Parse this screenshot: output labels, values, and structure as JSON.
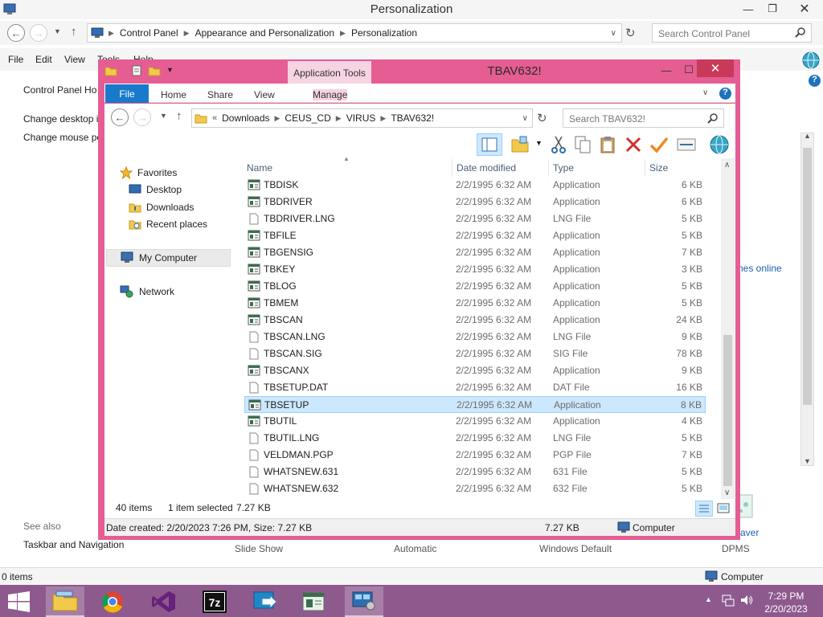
{
  "control_panel": {
    "title": "Personalization",
    "breadcrumbs": [
      "Control Panel",
      "Appearance and Personalization",
      "Personalization"
    ],
    "search_placeholder": "Search Control Panel",
    "menu": [
      "File",
      "Edit",
      "View",
      "Tools",
      "Help"
    ],
    "sidebar": {
      "home": "Control Panel Ho",
      "links": [
        "Change desktop i",
        "Change mouse po"
      ],
      "see_also_label": "See also",
      "see_also_links": [
        "Taskbar and Navigation"
      ]
    },
    "right_link_fragment": "nes online",
    "bottom_items": [
      "Slide Show",
      "Automatic",
      "Windows Default",
      "DPMS"
    ],
    "screen_saver_fragment": "aver",
    "status_left": "0 items",
    "status_right": "Computer"
  },
  "explorer": {
    "title": "TBAV632!",
    "contextual_tab": "Application Tools",
    "tabs": [
      "File",
      "Home",
      "Share",
      "View",
      "Manage"
    ],
    "breadcrumbs": [
      "Downloads",
      "CEUS_CD",
      "VIRUS",
      "TBAV632!"
    ],
    "search_placeholder": "Search TBAV632!",
    "nav_pane": {
      "favorites_label": "Favorites",
      "favorites": [
        "Desktop",
        "Downloads",
        "Recent places"
      ],
      "my_computer": "My Computer",
      "network": "Network"
    },
    "columns": [
      "Name",
      "Date modified",
      "Type",
      "Size"
    ],
    "files": [
      {
        "name": "TBDISK",
        "date": "2/2/1995 6:32 AM",
        "type": "Application",
        "size": "6 KB",
        "icon": "application-icon"
      },
      {
        "name": "TBDRIVER",
        "date": "2/2/1995 6:32 AM",
        "type": "Application",
        "size": "6 KB",
        "icon": "application-icon"
      },
      {
        "name": "TBDRIVER.LNG",
        "date": "2/2/1995 6:32 AM",
        "type": "LNG File",
        "size": "5 KB",
        "icon": "file-icon"
      },
      {
        "name": "TBFILE",
        "date": "2/2/1995 6:32 AM",
        "type": "Application",
        "size": "5 KB",
        "icon": "application-icon"
      },
      {
        "name": "TBGENSIG",
        "date": "2/2/1995 6:32 AM",
        "type": "Application",
        "size": "7 KB",
        "icon": "application-icon"
      },
      {
        "name": "TBKEY",
        "date": "2/2/1995 6:32 AM",
        "type": "Application",
        "size": "3 KB",
        "icon": "application-icon"
      },
      {
        "name": "TBLOG",
        "date": "2/2/1995 6:32 AM",
        "type": "Application",
        "size": "5 KB",
        "icon": "application-icon"
      },
      {
        "name": "TBMEM",
        "date": "2/2/1995 6:32 AM",
        "type": "Application",
        "size": "5 KB",
        "icon": "application-icon"
      },
      {
        "name": "TBSCAN",
        "date": "2/2/1995 6:32 AM",
        "type": "Application",
        "size": "24 KB",
        "icon": "application-icon"
      },
      {
        "name": "TBSCAN.LNG",
        "date": "2/2/1995 6:32 AM",
        "type": "LNG File",
        "size": "9 KB",
        "icon": "file-icon"
      },
      {
        "name": "TBSCAN.SIG",
        "date": "2/2/1995 6:32 AM",
        "type": "SIG File",
        "size": "78 KB",
        "icon": "file-icon"
      },
      {
        "name": "TBSCANX",
        "date": "2/2/1995 6:32 AM",
        "type": "Application",
        "size": "9 KB",
        "icon": "application-icon"
      },
      {
        "name": "TBSETUP.DAT",
        "date": "2/2/1995 6:32 AM",
        "type": "DAT File",
        "size": "16 KB",
        "icon": "file-icon"
      },
      {
        "name": "TBSETUP",
        "date": "2/2/1995 6:32 AM",
        "type": "Application",
        "size": "8 KB",
        "icon": "application-icon",
        "selected": true
      },
      {
        "name": "TBUTIL",
        "date": "2/2/1995 6:32 AM",
        "type": "Application",
        "size": "4 KB",
        "icon": "application-icon"
      },
      {
        "name": "TBUTIL.LNG",
        "date": "2/2/1995 6:32 AM",
        "type": "LNG File",
        "size": "5 KB",
        "icon": "file-icon"
      },
      {
        "name": "VELDMAN.PGP",
        "date": "2/2/1995 6:32 AM",
        "type": "PGP File",
        "size": "7 KB",
        "icon": "file-icon"
      },
      {
        "name": "WHATSNEW.631",
        "date": "2/2/1995 6:32 AM",
        "type": "631 File",
        "size": "5 KB",
        "icon": "file-icon"
      },
      {
        "name": "WHATSNEW.632",
        "date": "2/2/1995 6:32 AM",
        "type": "632 File",
        "size": "5 KB",
        "icon": "file-icon"
      }
    ],
    "status": {
      "item_count": "40 items",
      "selection": "1 item selected",
      "selection_size": "7.27 KB"
    },
    "details_bar": {
      "created": "Date created: 2/20/2023 7:26 PM, Size: 7.27 KB",
      "size": "7.27 KB",
      "location": "Computer"
    }
  },
  "taskbar": {
    "apps": [
      "file-explorer-icon",
      "chrome-icon",
      "visual-studio-icon",
      "7zip-icon",
      "remote-desktop-icon",
      "application-window-icon",
      "control-panel-icon"
    ],
    "time": "7:29 PM",
    "date": "2/20/2023"
  },
  "colors": {
    "window_accent": "#e55d93",
    "contextual_tab": "#f7d4e3",
    "file_tab": "#1979ca",
    "selection": "#cce8ff",
    "taskbar": "#8e5a8e"
  }
}
